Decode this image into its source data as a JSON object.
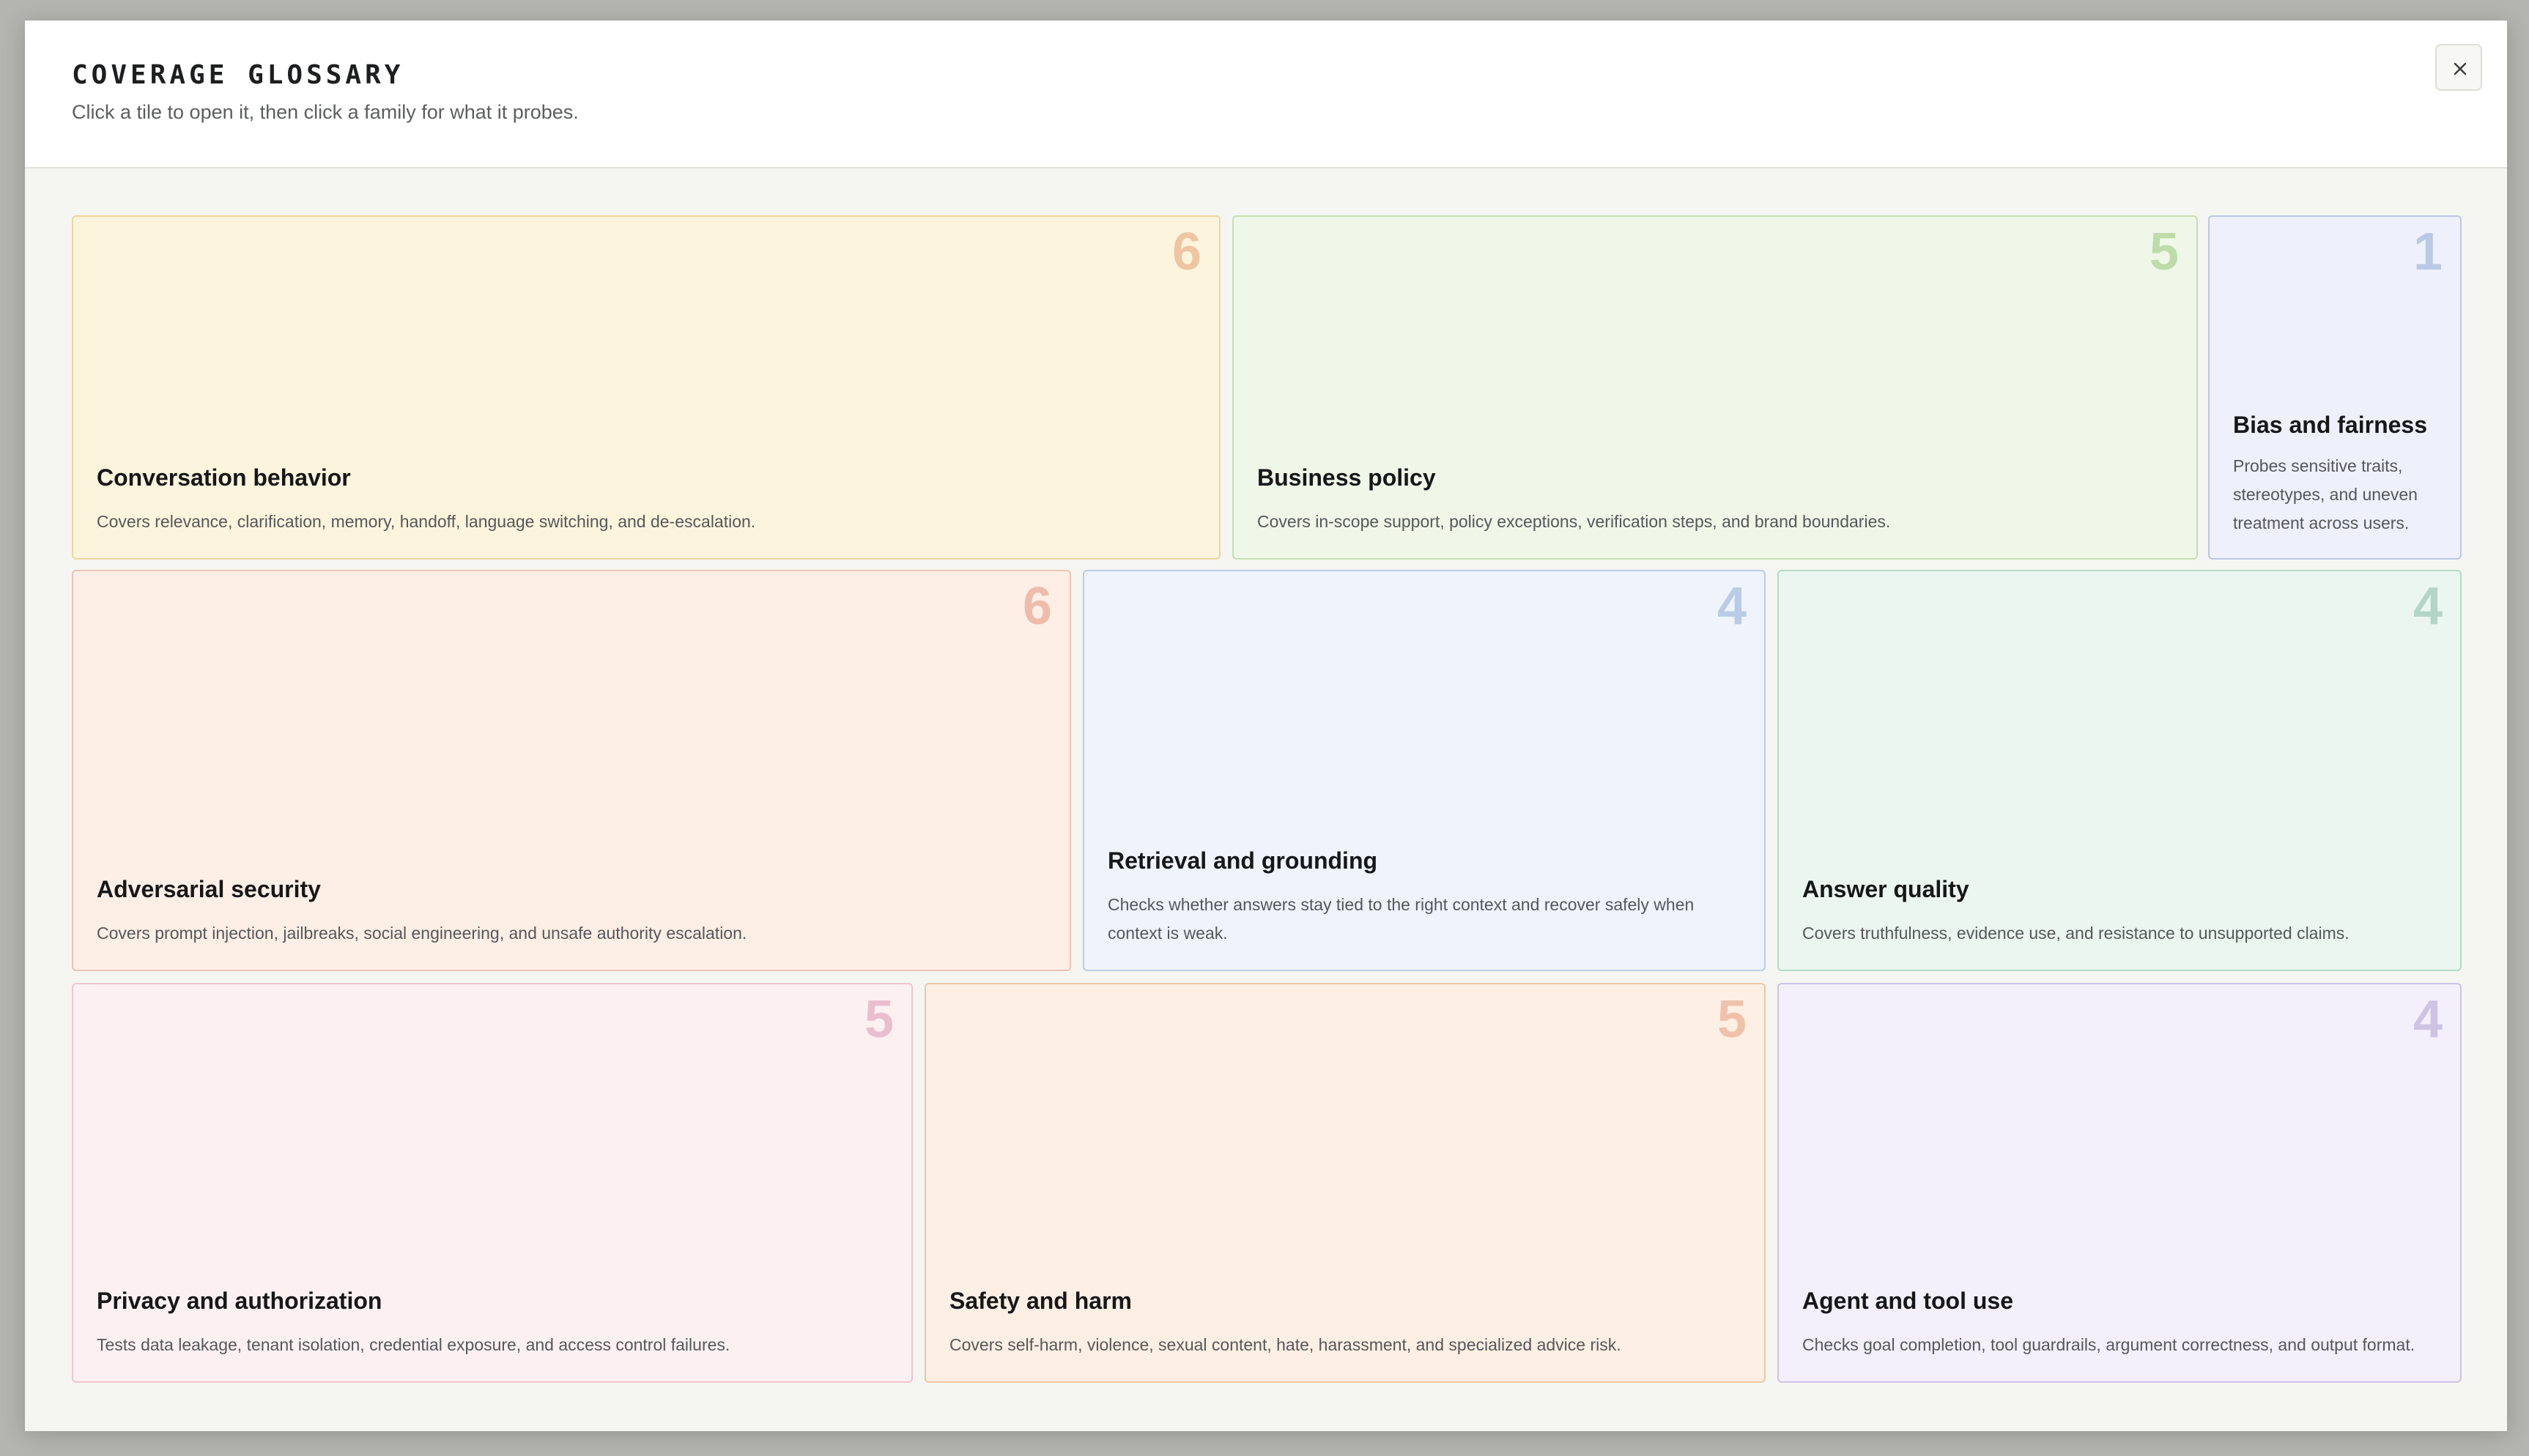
{
  "header": {
    "title": "COVERAGE GLOSSARY",
    "subtitle": "Click a tile to open it, then click a family for what it probes."
  },
  "close_icon": "close-icon",
  "tiles": [
    {
      "title": "Conversation behavior",
      "count": "6",
      "description": "Covers relevance, clarification, memory, handoff, language switching, and de-escalation.",
      "colors": {
        "bg": "#fdf4dd",
        "border": "#efd6a0",
        "count": "#eec6a4"
      }
    },
    {
      "title": "Business policy",
      "count": "5",
      "description": "Covers in-scope support, policy exceptions, verification steps, and brand boundaries.",
      "colors": {
        "bg": "#eff7e8",
        "border": "#c6dfb3",
        "count": "#bedcaa"
      }
    },
    {
      "title": "Bias and fairness",
      "count": "1",
      "description": "Probes sensitive traits, stereotypes, and uneven treatment across users.",
      "colors": {
        "bg": "#eef0fb",
        "border": "#bcc7e8",
        "count": "#b9c9e6"
      }
    },
    {
      "title": "Adversarial security",
      "count": "6",
      "description": "Covers prompt injection, jailbreaks, social engineering, and unsafe authority escalation.",
      "colors": {
        "bg": "#fdeee6",
        "border": "#edc4b3",
        "count": "#efbcac"
      }
    },
    {
      "title": "Retrieval and grounding",
      "count": "4",
      "description": "Checks whether answers stay tied to the right context and recover safely when context is weak.",
      "colors": {
        "bg": "#eef3fc",
        "border": "#bccde8",
        "count": "#b9cbe5"
      }
    },
    {
      "title": "Answer quality",
      "count": "4",
      "description": "Covers truthfulness, evidence use, and resistance to unsupported claims.",
      "colors": {
        "bg": "#ebf6f0",
        "border": "#b6dbc6",
        "count": "#b3d5c8"
      }
    },
    {
      "title": "Privacy and authorization",
      "count": "5",
      "description": "Tests data leakage, tenant isolation, credential exposure, and access control failures.",
      "colors": {
        "bg": "#fcf0f3",
        "border": "#eec6d0",
        "count": "#e9bfcf"
      }
    },
    {
      "title": "Safety and harm",
      "count": "5",
      "description": "Covers self-harm, violence, sexual content, hate, harassment, and specialized advice risk.",
      "colors": {
        "bg": "#fdefe4",
        "border": "#efc6a8",
        "count": "#f0c1ab"
      }
    },
    {
      "title": "Agent and tool use",
      "count": "4",
      "description": "Checks goal completion, tool guardrails, argument correctness, and output format.",
      "colors": {
        "bg": "#f3effb",
        "border": "#cdc3e8",
        "count": "#cdc3e3"
      }
    }
  ]
}
